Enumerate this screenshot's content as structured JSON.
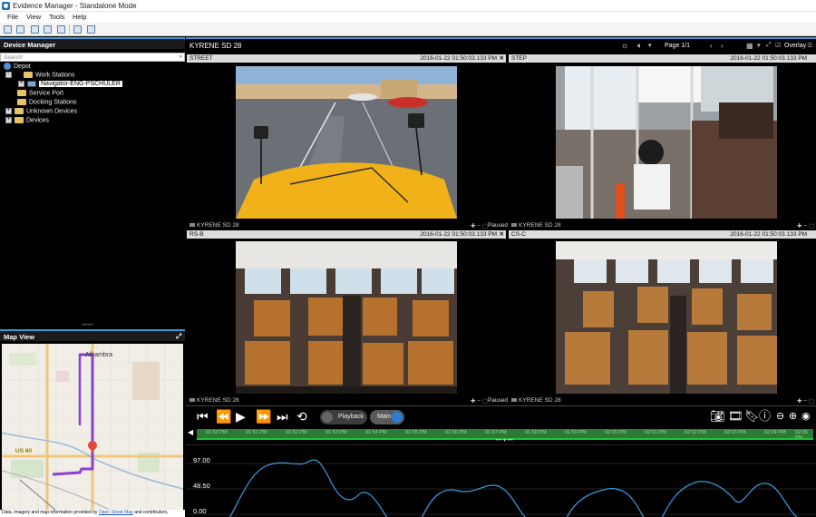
{
  "window": {
    "title": "Evidence Manager - Standalone Mode"
  },
  "menu": [
    "File",
    "View",
    "Tools",
    "Help"
  ],
  "device_manager": {
    "title": "Device Manager",
    "search_placeholder": "Search",
    "tree": [
      {
        "label": "Depot",
        "level": 0,
        "icon": "depot-icon"
      },
      {
        "label": "Work Stations",
        "level": 1,
        "icon": "folder-icon",
        "expander": "-"
      },
      {
        "label": "Navigator-ENG-PSCHULER",
        "level": 2,
        "icon": "monitor-icon",
        "expander": "+",
        "selected": true
      },
      {
        "label": "Service Port",
        "level": 1,
        "icon": "folder-icon"
      },
      {
        "label": "Docking Stations",
        "level": 1,
        "icon": "folder-icon"
      },
      {
        "label": "Unknown Devices",
        "level": 1,
        "icon": "folder-icon",
        "expander": "+"
      },
      {
        "label": "Devices",
        "level": 1,
        "icon": "folder-icon",
        "expander": "+"
      }
    ]
  },
  "map_view": {
    "title": "Map View",
    "place_label": "Alhambra",
    "road_label": "US 60",
    "credit_text": "Data, imagery and map information provided by",
    "credit_link": "Open Street Map",
    "credit_suffix": "and contributors,"
  },
  "video": {
    "vehicle": "KYRENE SD 28",
    "page": "Page 1/1",
    "overlay": "Overlay",
    "tiles": [
      {
        "camera": "STREET",
        "timestamp": "2016-01-22 01:50:03.133 PM",
        "footer": "KYRENE SD 28",
        "paused": ""
      },
      {
        "camera": "STEP",
        "timestamp": "2016-01-22 01:50:03.133 PM",
        "footer": "KYRENE SD 28",
        "paused": ""
      },
      {
        "camera": "RS-B",
        "timestamp": "2016-01-22 01:50:03.133 PM",
        "footer": "KYRENE SD 28",
        "paused": "Paused"
      },
      {
        "camera": "CS-C",
        "timestamp": "2016-01-22 01:50:03.133 PM",
        "footer": "KYRENE SD 28",
        "paused": ""
      }
    ],
    "first_tile_paused": "Paused"
  },
  "playback": {
    "playback_label": "Playback",
    "main_label": "Main",
    "timeline_ticks": [
      "01:50 PM",
      "01:51 PM",
      "01:52 PM",
      "01:53 PM",
      "01:54 PM",
      "01:55 PM",
      "01:56 PM",
      "01:57 PM",
      "01:58 PM",
      "01:59 PM",
      "02:00 PM",
      "02:01 PM",
      "02:02 PM",
      "02:03 PM",
      "02:04 PM",
      "02:05 PM"
    ]
  },
  "graph": {
    "y_labels": [
      "97.00",
      "48.50",
      "0.00"
    ]
  },
  "colors": {
    "accent": "#3a96d8",
    "timeline": "#2c7a35",
    "graph_line": "#3aa0e0",
    "route": "#8a3fd1"
  }
}
